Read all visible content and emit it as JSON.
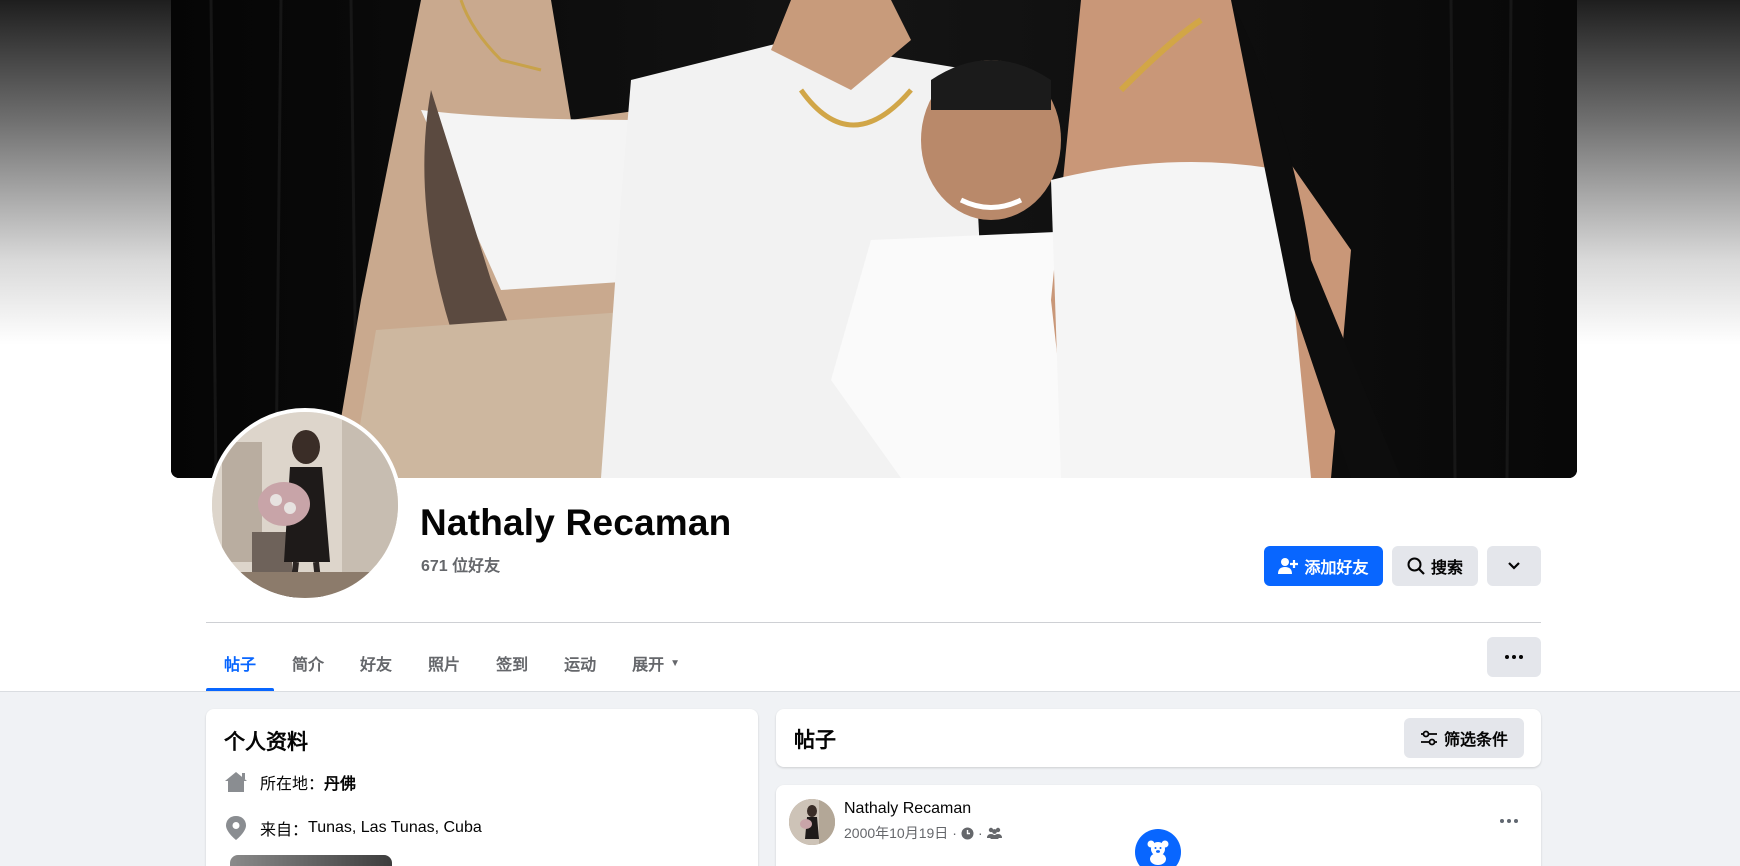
{
  "profile": {
    "name": "Nathaly Recaman",
    "friends_count": "671 位好友"
  },
  "actions": {
    "add_friend": "添加好友",
    "search": "搜索",
    "more_icon": "chevron-down-icon"
  },
  "tabs": [
    {
      "label": "帖子",
      "active": true
    },
    {
      "label": "简介"
    },
    {
      "label": "好友"
    },
    {
      "label": "照片"
    },
    {
      "label": "签到"
    },
    {
      "label": "运动"
    },
    {
      "label": "展开"
    }
  ],
  "intro": {
    "title": "个人资料",
    "lives_in_label": "所在地：",
    "lives_in_value": "丹佛",
    "from_label": "来自：",
    "from_value": "Tunas, Las Tunas, Cuba"
  },
  "posts": {
    "title": "帖子",
    "filter_label": "筛选条件",
    "items": [
      {
        "author": "Nathaly Recaman",
        "date": "2000年10月19日",
        "privacy_icons": [
          "clock-icon",
          "friends-icon"
        ],
        "life_event_icon": "teddy-bear-icon"
      }
    ]
  },
  "colors": {
    "accent": "#0866ff",
    "secondary_button": "#e4e6eb",
    "muted_text": "#65676b",
    "page_background": "#f0f2f5"
  }
}
